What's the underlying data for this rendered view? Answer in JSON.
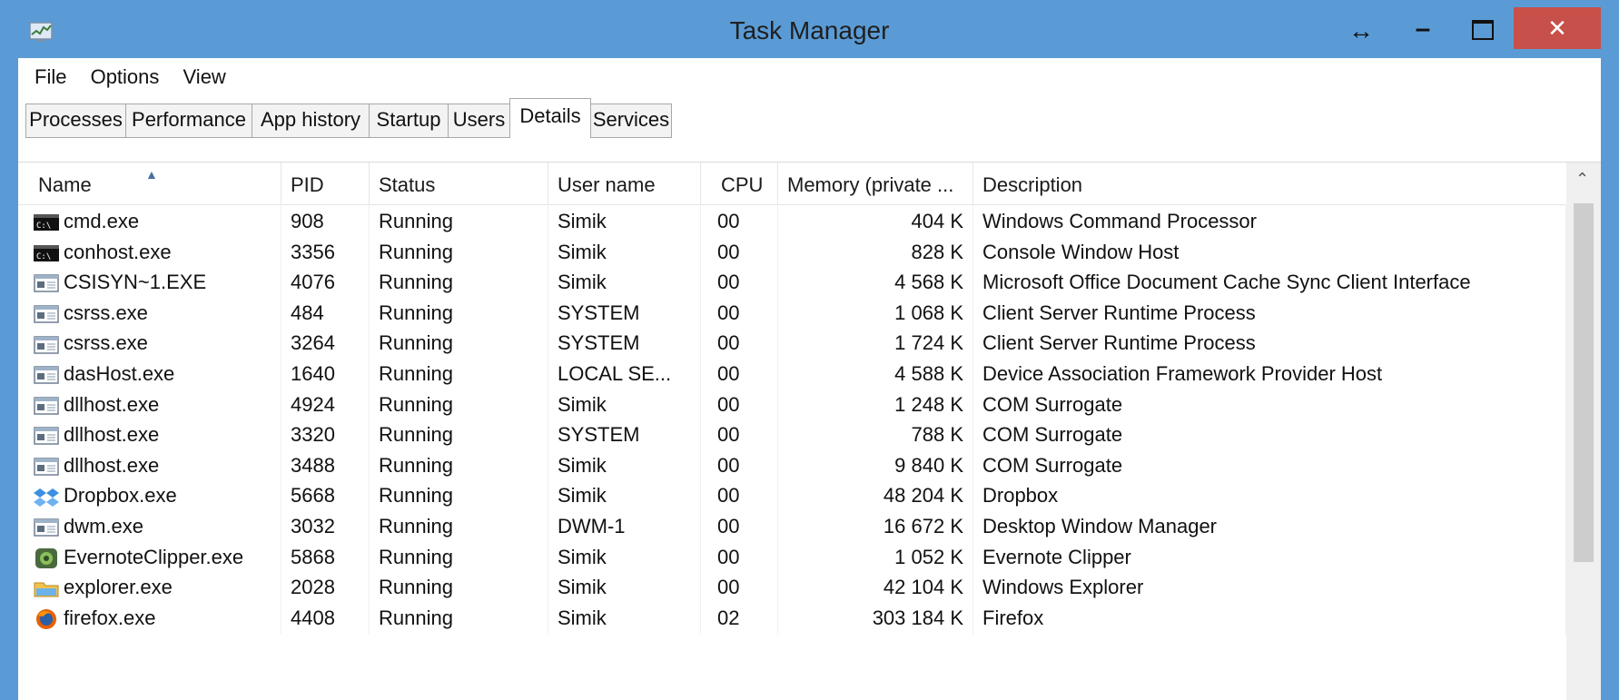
{
  "window": {
    "title": "Task Manager",
    "app_icon": "task-manager-icon",
    "controls": {
      "resize_icon": "↔",
      "minimize": "–",
      "close": "✕"
    }
  },
  "menu": [
    "File",
    "Options",
    "View"
  ],
  "tabs": [
    {
      "label": "Processes",
      "active": false
    },
    {
      "label": "Performance",
      "active": false
    },
    {
      "label": "App history",
      "active": false
    },
    {
      "label": "Startup",
      "active": false
    },
    {
      "label": "Users",
      "active": false
    },
    {
      "label": "Details",
      "active": true
    },
    {
      "label": "Services",
      "active": false
    }
  ],
  "columns": {
    "name": "Name",
    "pid": "PID",
    "status": "Status",
    "user": "User name",
    "cpu": "CPU",
    "memory": "Memory (private ...",
    "description": "Description"
  },
  "rows": [
    {
      "icon": "console-icon",
      "name": "cmd.exe",
      "pid": "908",
      "status": "Running",
      "user": "Simik",
      "cpu": "00",
      "memory": "404 K",
      "description": "Windows Command Processor"
    },
    {
      "icon": "console-icon",
      "name": "conhost.exe",
      "pid": "3356",
      "status": "Running",
      "user": "Simik",
      "cpu": "00",
      "memory": "828 K",
      "description": "Console Window Host"
    },
    {
      "icon": "window-icon",
      "name": "CSISYN~1.EXE",
      "pid": "4076",
      "status": "Running",
      "user": "Simik",
      "cpu": "00",
      "memory": "4 568 K",
      "description": "Microsoft Office Document Cache Sync Client Interface"
    },
    {
      "icon": "window-icon",
      "name": "csrss.exe",
      "pid": "484",
      "status": "Running",
      "user": "SYSTEM",
      "cpu": "00",
      "memory": "1 068 K",
      "description": "Client Server Runtime Process"
    },
    {
      "icon": "window-icon",
      "name": "csrss.exe",
      "pid": "3264",
      "status": "Running",
      "user": "SYSTEM",
      "cpu": "00",
      "memory": "1 724 K",
      "description": "Client Server Runtime Process"
    },
    {
      "icon": "window-icon",
      "name": "dasHost.exe",
      "pid": "1640",
      "status": "Running",
      "user": "LOCAL SE...",
      "cpu": "00",
      "memory": "4 588 K",
      "description": "Device Association Framework Provider Host"
    },
    {
      "icon": "window-icon",
      "name": "dllhost.exe",
      "pid": "4924",
      "status": "Running",
      "user": "Simik",
      "cpu": "00",
      "memory": "1 248 K",
      "description": "COM Surrogate"
    },
    {
      "icon": "window-icon",
      "name": "dllhost.exe",
      "pid": "3320",
      "status": "Running",
      "user": "SYSTEM",
      "cpu": "00",
      "memory": "788 K",
      "description": "COM Surrogate"
    },
    {
      "icon": "window-icon",
      "name": "dllhost.exe",
      "pid": "3488",
      "status": "Running",
      "user": "Simik",
      "cpu": "00",
      "memory": "9 840 K",
      "description": "COM Surrogate"
    },
    {
      "icon": "dropbox-icon",
      "name": "Dropbox.exe",
      "pid": "5668",
      "status": "Running",
      "user": "Simik",
      "cpu": "00",
      "memory": "48 204 K",
      "description": "Dropbox"
    },
    {
      "icon": "window-icon",
      "name": "dwm.exe",
      "pid": "3032",
      "status": "Running",
      "user": "DWM-1",
      "cpu": "00",
      "memory": "16 672 K",
      "description": "Desktop Window Manager"
    },
    {
      "icon": "evernote-icon",
      "name": "EvernoteClipper.exe",
      "pid": "5868",
      "status": "Running",
      "user": "Simik",
      "cpu": "00",
      "memory": "1 052 K",
      "description": "Evernote Clipper"
    },
    {
      "icon": "explorer-icon",
      "name": "explorer.exe",
      "pid": "2028",
      "status": "Running",
      "user": "Simik",
      "cpu": "00",
      "memory": "42 104 K",
      "description": "Windows Explorer"
    },
    {
      "icon": "firefox-icon",
      "name": "firefox.exe",
      "pid": "4408",
      "status": "Running",
      "user": "Simik",
      "cpu": "02",
      "memory": "303 184 K",
      "description": "Firefox"
    }
  ],
  "colors": {
    "title_bar": "#5a9bd5",
    "close_button": "#c7504b",
    "scroll_thumb": "#cdcdcd"
  }
}
